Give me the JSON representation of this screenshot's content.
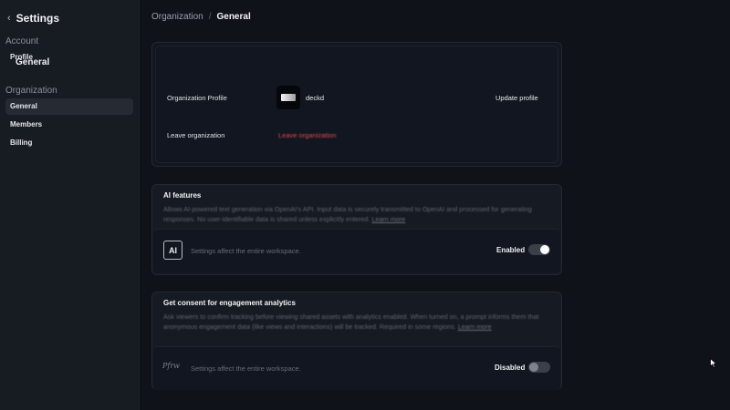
{
  "sidebar": {
    "back_icon": "chevron-left-icon",
    "title": "Settings",
    "sections": [
      {
        "label": "Account",
        "items": [
          {
            "label": "Profile"
          }
        ]
      },
      {
        "label": "Organization",
        "items": [
          {
            "label": "General",
            "active": true
          },
          {
            "label": "Members"
          },
          {
            "label": "Billing"
          }
        ]
      }
    ]
  },
  "breadcrumb": {
    "parent": "Organization",
    "current": "General"
  },
  "general": {
    "title": "General",
    "org_profile_label": "Organization Profile",
    "org_name": "deckd",
    "update_profile": "Update profile",
    "leave_label": "Leave organization",
    "leave_action": "Leave organization"
  },
  "ai_features": {
    "title": "AI features",
    "description": "Allows AI-powered text generation via OpenAI's API. Input data is securely transmitted to OpenAI and processed for generating responses. No user-identifiable data is shared unless explicitly entered.",
    "learn_more": "Learn more",
    "icon_text": "AI",
    "note": "Settings affect the entire workspace.",
    "status": "Enabled",
    "enabled": true
  },
  "consent": {
    "title": "Get consent for engagement analytics",
    "description": "Ask viewers to confirm tracking before viewing shared assets with analytics enabled. When turned on, a prompt informs them that anonymous engagement data (like views and interactions) will be tracked. Required in some regions.",
    "learn_more": "Learn more",
    "icon": "signature-icon",
    "note": "Settings affect the entire workspace.",
    "status": "Disabled",
    "enabled": false
  },
  "colors": {
    "background": "#0f1218",
    "sidebar": "#171b22",
    "danger": "#e5484d",
    "toggle_on_knob": "#ffffff"
  }
}
